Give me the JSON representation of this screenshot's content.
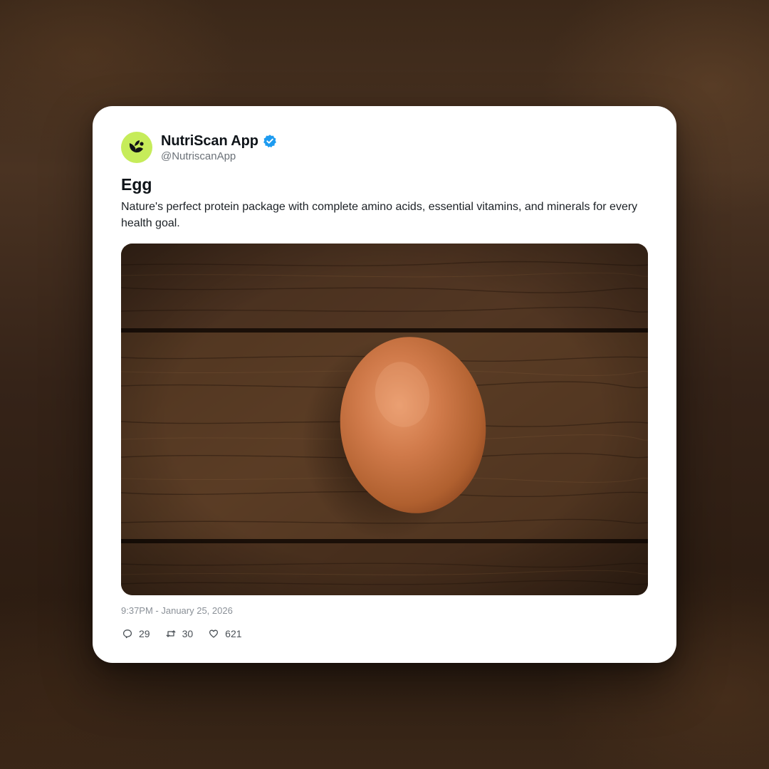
{
  "post": {
    "display_name": "NutriScan App",
    "handle": "@NutriscanApp",
    "verified": true,
    "title": "Egg",
    "description": "Nature's perfect protein package with complete amino acids, essential vitamins, and minerals for every health goal.",
    "timestamp": "9:37PM - January 25, 2026",
    "stats": {
      "replies": "29",
      "reposts": "30",
      "likes": "621"
    }
  },
  "icons": {
    "avatar": "leaf-logo-icon",
    "verified": "verified-badge-icon",
    "replies": "reply-icon",
    "reposts": "repost-icon",
    "likes": "heart-icon"
  },
  "colors": {
    "avatar_bg": "#c6ec5a",
    "verified": "#1d9bf0",
    "text_primary": "#0f1419",
    "text_secondary": "#6b7178"
  }
}
